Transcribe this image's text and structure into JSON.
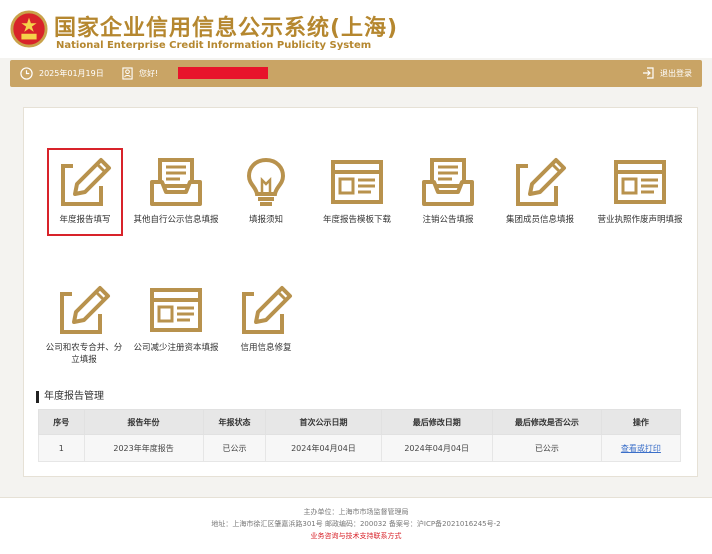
{
  "header": {
    "title_cn": "国家企业信用信息公示系统(上海)",
    "title_en": "National Enterprise Credit Information Publicity System"
  },
  "infobar": {
    "date": "2025年01月19日",
    "greeting": "您好!",
    "logout": "退出登录"
  },
  "tiles": [
    {
      "label": "年度报告填写",
      "icon": "pencil-doc-icon"
    },
    {
      "label": "其他自行公示信息填报",
      "icon": "inbox-tray-icon"
    },
    {
      "label": "填报须知",
      "icon": "lightbulb-icon"
    },
    {
      "label": "年度报告模板下载",
      "icon": "template-window-icon"
    },
    {
      "label": "注销公告填报",
      "icon": "inbox-tray-icon"
    },
    {
      "label": "集团成员信息填报",
      "icon": "pencil-doc-icon"
    },
    {
      "label": "营业执照作废声明填报",
      "icon": "template-window-icon"
    },
    {
      "label": "公司和农专合并、分立填报",
      "icon": "pencil-doc-icon"
    },
    {
      "label": "公司减少注册资本填报",
      "icon": "template-window-icon"
    },
    {
      "label": "信用信息修复",
      "icon": "pencil-doc-icon"
    }
  ],
  "section": {
    "title": "年度报告管理"
  },
  "table": {
    "headers": [
      "序号",
      "报告年份",
      "年报状态",
      "首次公示日期",
      "最后修改日期",
      "最后修改是否公示",
      "操作"
    ],
    "rows": [
      [
        "1",
        "2023年年度报告",
        "已公示",
        "2024年04月04日",
        "2024年04月04日",
        "已公示",
        "查看或打印"
      ]
    ]
  },
  "footer": {
    "line1": "主办单位：上海市市场监督管理局",
    "line2": "地址：上海市徐汇区肇嘉浜路301号 邮政编码：200032 备案号：沪ICP备2021016245号-2",
    "line3": "业务咨询与技术支持联系方式"
  },
  "colors": {
    "gold": "#c9a465",
    "icon": "#b8924d",
    "red": "#d8232a",
    "link": "#3b6fc9"
  }
}
